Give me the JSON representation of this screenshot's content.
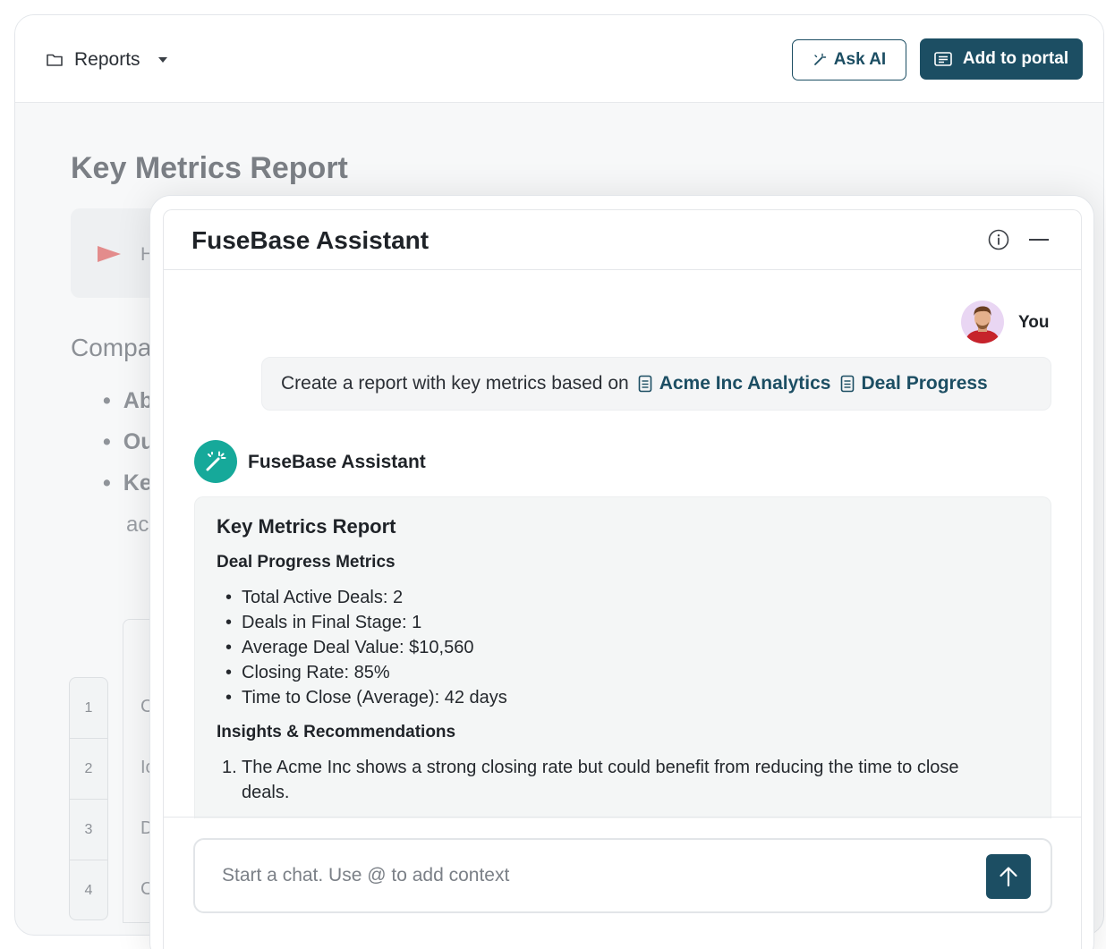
{
  "topbar": {
    "breadcrumb_label": "Reports",
    "ask_ai_label": "Ask AI",
    "add_to_portal_label": "Add to portal"
  },
  "document": {
    "title": "Key Metrics Report",
    "callout_text": "H",
    "section_heading": "Compa",
    "bullets": [
      "Ab",
      "Ou",
      "Ke"
    ],
    "bullet_continuation": "ac",
    "table_row_numbers": [
      "1",
      "2",
      "3",
      "4"
    ],
    "table_cells": [
      "C",
      "Ic",
      "D",
      "C"
    ]
  },
  "assistant": {
    "title": "FuseBase Assistant",
    "user": {
      "label": "You",
      "message_prefix": "Create a report with key metrics based on",
      "references": [
        "Acme Inc Analytics",
        "Deal Progress"
      ]
    },
    "bot": {
      "name": "FuseBase Assistant",
      "report_title": "Key Metrics Report",
      "section1_title": "Deal Progress Metrics",
      "metrics": [
        "Total Active Deals: 2",
        "Deals in Final Stage: 1",
        "Average Deal Value: $10,560",
        "Closing Rate: 85%",
        "Time to Close (Average): 42 days"
      ],
      "section2_title": "Insights & Recommendations",
      "insights": [
        {
          "num": "1.",
          "text": "The Acme Inc shows a strong closing rate but could benefit from reducing the time to close deals."
        }
      ]
    },
    "composer": {
      "placeholder": "Start a chat. Use @ to add context",
      "value": ""
    }
  },
  "colors": {
    "brand": "#1c4e63",
    "assistant_avatar": "#16a99a",
    "callout_flag": "#e38c8c"
  },
  "icons": [
    "folder-icon",
    "caret-down-icon",
    "magic-wand-icon",
    "portal-icon",
    "info-icon",
    "minimize-icon",
    "document-icon",
    "arrow-up-icon"
  ]
}
